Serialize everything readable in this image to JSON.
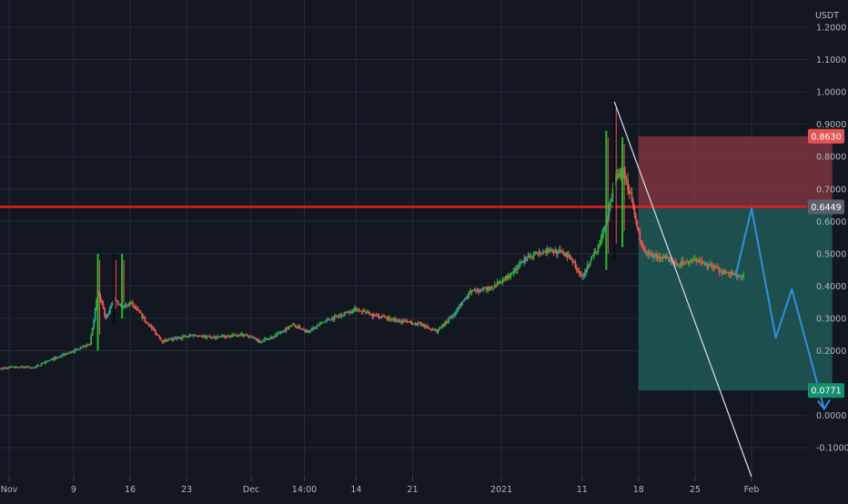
{
  "chart_data": {
    "type": "candlestick",
    "currency_label": "USDT",
    "theme": {
      "background": "#131722",
      "grid": "#262b38",
      "text": "#b2b5be",
      "up": "#26a69a",
      "up_bright": "#1fbf2a",
      "down": "#ef5350",
      "resistance": "#e02020",
      "trendline": "#d1d4dc",
      "projection": "#2f8fe0",
      "stop_zone": "#8c3a44",
      "target_zone": "#1e5955",
      "stop_badge": "#e55353",
      "entry_badge": "#5d606b",
      "target_badge": "#15906e"
    },
    "y_axis": {
      "range": [
        -0.15,
        1.28
      ],
      "ticks": [
        {
          "value": 1.2,
          "label": "1.2000"
        },
        {
          "value": 1.1,
          "label": "1.1000"
        },
        {
          "value": 1.0,
          "label": "1.0000"
        },
        {
          "value": 0.9,
          "label": "0.9000"
        },
        {
          "value": 0.8,
          "label": "0.8000"
        },
        {
          "value": 0.7,
          "label": "0.7000"
        },
        {
          "value": 0.6,
          "label": "0.6000"
        },
        {
          "value": 0.5,
          "label": "0.5000"
        },
        {
          "value": 0.4,
          "label": "0.4000"
        },
        {
          "value": 0.3,
          "label": "0.3000"
        },
        {
          "value": 0.2,
          "label": "0.2000"
        },
        {
          "value": 0.0,
          "label": "0.0000"
        },
        {
          "value": -0.1,
          "label": "-0.1000"
        }
      ],
      "badges": [
        {
          "value": 0.863,
          "label": "0.8630",
          "color": "#e55353"
        },
        {
          "value": 0.6449,
          "label": "0.6449",
          "color": "#5d606b"
        },
        {
          "value": 0.0771,
          "label": "0.0771",
          "color": "#15906e"
        }
      ]
    },
    "x_axis": {
      "ticks": [
        {
          "date": "2020-11-01",
          "label": "Nov"
        },
        {
          "date": "2020-11-09",
          "label": "9"
        },
        {
          "date": "2020-11-16",
          "label": "16"
        },
        {
          "date": "2020-11-23",
          "label": "23"
        },
        {
          "date": "2020-12-01",
          "label": "Dec"
        },
        {
          "date": "2020-12-07 14:00",
          "label": "14:00"
        },
        {
          "date": "2020-12-14",
          "label": "14"
        },
        {
          "date": "2020-12-21",
          "label": "21"
        },
        {
          "date": "2021-01-01",
          "label": "2021"
        },
        {
          "date": "2021-01-11",
          "label": "11"
        },
        {
          "date": "2021-01-18",
          "label": "18"
        },
        {
          "date": "2021-01-25",
          "label": "25"
        },
        {
          "date": "2021-02-01",
          "label": "Feb"
        }
      ]
    },
    "price_path": [
      [
        "2020-10-31",
        0.145
      ],
      [
        "2020-11-02",
        0.15
      ],
      [
        "2020-11-04",
        0.148
      ],
      [
        "2020-11-06",
        0.17
      ],
      [
        "2020-11-08",
        0.19
      ],
      [
        "2020-11-09",
        0.2
      ],
      [
        "2020-11-11",
        0.22
      ],
      [
        "2020-11-12",
        0.38
      ],
      [
        "2020-11-13",
        0.3
      ],
      [
        "2020-11-14",
        0.36
      ],
      [
        "2020-11-15",
        0.33
      ],
      [
        "2020-11-16",
        0.35
      ],
      [
        "2020-11-17",
        0.32
      ],
      [
        "2020-11-18",
        0.29
      ],
      [
        "2020-11-19",
        0.26
      ],
      [
        "2020-11-20",
        0.23
      ],
      [
        "2020-11-22",
        0.24
      ],
      [
        "2020-11-24",
        0.25
      ],
      [
        "2020-11-26",
        0.24
      ],
      [
        "2020-11-28",
        0.245
      ],
      [
        "2020-11-30",
        0.25
      ],
      [
        "2020-12-02",
        0.23
      ],
      [
        "2020-12-04",
        0.245
      ],
      [
        "2020-12-06",
        0.28
      ],
      [
        "2020-12-08",
        0.26
      ],
      [
        "2020-12-10",
        0.29
      ],
      [
        "2020-12-12",
        0.31
      ],
      [
        "2020-12-14",
        0.33
      ],
      [
        "2020-12-16",
        0.31
      ],
      [
        "2020-12-18",
        0.3
      ],
      [
        "2020-12-20",
        0.29
      ],
      [
        "2020-12-22",
        0.28
      ],
      [
        "2020-12-24",
        0.26
      ],
      [
        "2020-12-26",
        0.31
      ],
      [
        "2020-12-28",
        0.38
      ],
      [
        "2020-12-30",
        0.39
      ],
      [
        "2021-01-01",
        0.41
      ],
      [
        "2021-01-03",
        0.46
      ],
      [
        "2021-01-05",
        0.5
      ],
      [
        "2021-01-07",
        0.51
      ],
      [
        "2021-01-09",
        0.5
      ],
      [
        "2021-01-10",
        0.47
      ],
      [
        "2021-01-11",
        0.43
      ],
      [
        "2021-01-12",
        0.48
      ],
      [
        "2021-01-13",
        0.52
      ],
      [
        "2021-01-14",
        0.6
      ],
      [
        "2021-01-15",
        0.72
      ],
      [
        "2021-01-16",
        0.76
      ],
      [
        "2021-01-17",
        0.68
      ],
      [
        "2021-01-18",
        0.56
      ],
      [
        "2021-01-19",
        0.5
      ],
      [
        "2021-01-21",
        0.49
      ],
      [
        "2021-01-23",
        0.47
      ],
      [
        "2021-01-25",
        0.48
      ],
      [
        "2021-01-27",
        0.46
      ],
      [
        "2021-01-29",
        0.44
      ],
      [
        "2021-01-31",
        0.43
      ]
    ],
    "spikes": [
      {
        "date": "2020-11-12",
        "low": 0.2,
        "high": 0.5
      },
      {
        "date": "2020-11-14",
        "low": 0.28,
        "high": 0.5
      },
      {
        "date": "2020-11-15",
        "low": 0.3,
        "high": 0.5
      },
      {
        "date": "2021-01-14",
        "low": 0.45,
        "high": 0.88
      },
      {
        "date": "2021-01-15",
        "low": 0.48,
        "high": 0.97
      },
      {
        "date": "2021-01-16",
        "low": 0.52,
        "high": 0.86
      }
    ],
    "annotations": {
      "resistance_line": {
        "price": 0.6449
      },
      "stop_zone": {
        "x_from": "2021-01-18",
        "x_to": "2021-02-11",
        "low": 0.6449,
        "high": 0.863
      },
      "target_zone": {
        "x_from": "2021-01-18",
        "x_to": "2021-02-11",
        "low": 0.0771,
        "high": 0.6449
      },
      "trendline": {
        "from": [
          "2021-01-15",
          0.97
        ],
        "to": [
          "2021-02-01",
          -0.19
        ]
      },
      "projection_path": [
        [
          "2021-01-30",
          0.43
        ],
        [
          "2021-02-01",
          0.64
        ],
        [
          "2021-02-04",
          0.24
        ],
        [
          "2021-02-06",
          0.39
        ],
        [
          "2021-02-10",
          0.02
        ]
      ]
    }
  }
}
